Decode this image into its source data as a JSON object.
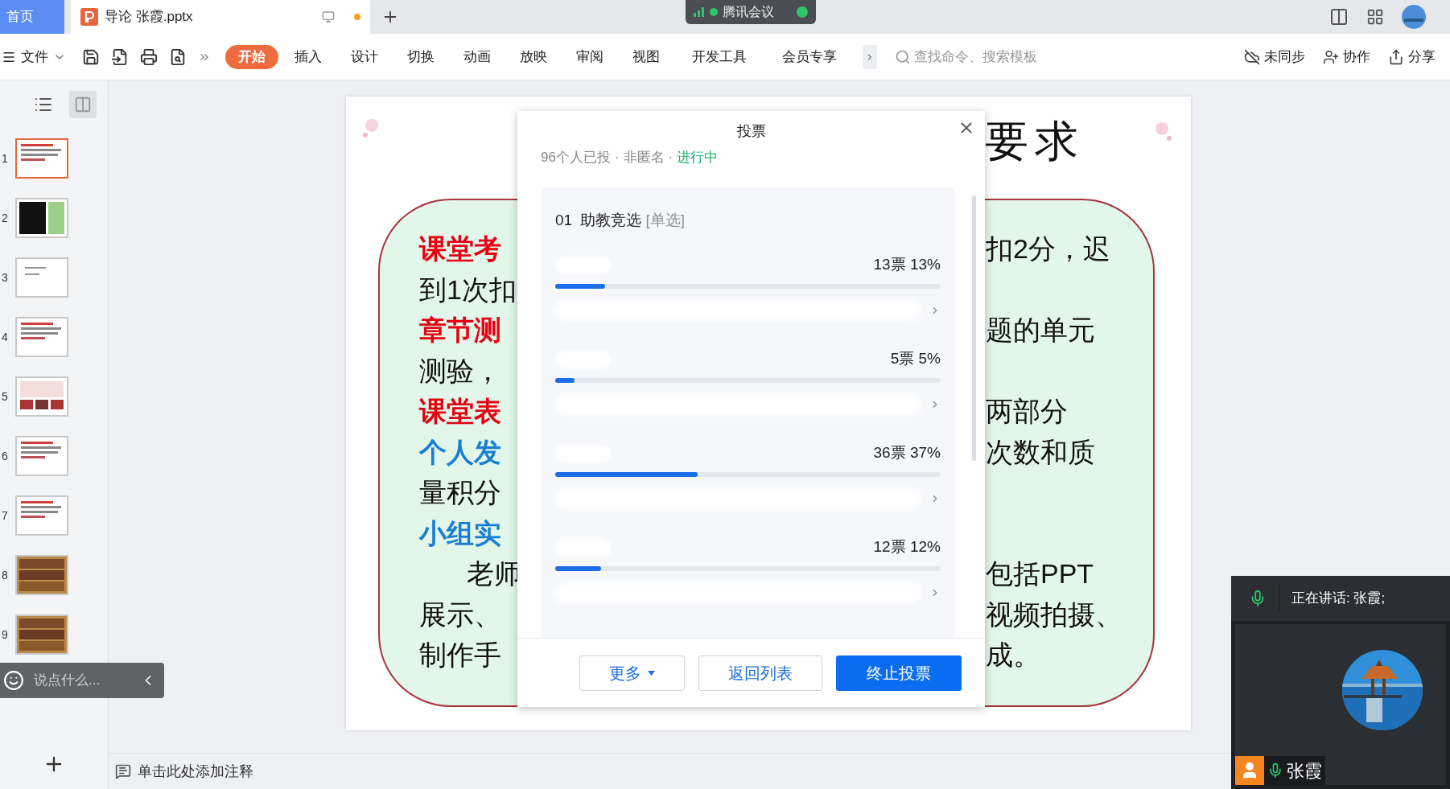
{
  "tabs": [
    {
      "label": "首页",
      "kind": "home",
      "selected": false
    },
    {
      "label": "导论 张霞.pptx",
      "kind": "doc",
      "selected": true,
      "unsaved": true
    }
  ],
  "meeting": {
    "title": "腾讯会议"
  },
  "menu": {
    "label": "文件"
  },
  "ribbon_tabs": [
    {
      "label": "开始",
      "selected": true
    },
    {
      "label": "插入",
      "selected": false
    },
    {
      "label": "设计",
      "selected": false
    },
    {
      "label": "切换",
      "selected": false
    },
    {
      "label": "动画",
      "selected": false
    },
    {
      "label": "放映",
      "selected": false
    },
    {
      "label": "审阅",
      "selected": false
    },
    {
      "label": "视图",
      "selected": false
    },
    {
      "label": "开发工具",
      "selected": false
    },
    {
      "label": "会员专享",
      "selected": false
    }
  ],
  "search": {
    "placeholder": "查找命令、搜索模板"
  },
  "actions": [
    {
      "label": "未同步",
      "kind": "cloud"
    },
    {
      "label": "协作",
      "kind": "people"
    },
    {
      "label": "分享",
      "kind": "share"
    }
  ],
  "thumbnails": [
    {
      "number": "1",
      "kind": "text",
      "selected": true
    },
    {
      "number": "2",
      "kind": "table",
      "selected": false
    },
    {
      "number": "3",
      "kind": "blank",
      "selected": false
    },
    {
      "number": "4",
      "kind": "text",
      "selected": false
    },
    {
      "number": "5",
      "kind": "photos",
      "selected": false
    },
    {
      "number": "6",
      "kind": "text",
      "selected": false
    },
    {
      "number": "7",
      "kind": "text",
      "selected": false
    },
    {
      "number": "8",
      "kind": "shelf",
      "selected": false
    },
    {
      "number": "9",
      "kind": "shelf",
      "selected": false
    }
  ],
  "chat": {
    "placeholder": "说点什么..."
  },
  "slide": {
    "title_right": "要求",
    "rows": [
      {
        "left": "课堂考",
        "color": "#e60012",
        "right": "扣2分，迟",
        "indent": false
      },
      {
        "left": "到1次扣",
        "color": "#111111",
        "indent": false
      },
      {
        "left": "章节测",
        "color": "#e60012",
        "right": "题的单元",
        "indent": false
      },
      {
        "left": "测验，",
        "color": "#111111",
        "indent": false
      },
      {
        "left": "课堂表",
        "color": "#e60012",
        "right": "两部分",
        "indent": false
      },
      {
        "left": "个人发",
        "color": "#1a7fd4",
        "right": "次数和质",
        "indent": false
      },
      {
        "left": "量积分",
        "color": "#111111",
        "indent": false
      },
      {
        "left": "小组实",
        "color": "#1a7fd4",
        "indent": false
      },
      {
        "left": "老师",
        "color": "#111111",
        "right": "包括PPT",
        "indent": true
      },
      {
        "left": "展示、",
        "color": "#111111",
        "right": "视频拍摄、",
        "indent": false
      },
      {
        "left": "制作手",
        "color": "#111111",
        "right": "成。",
        "indent": false
      }
    ]
  },
  "poll": {
    "title": "投票",
    "voters": "96个人已投",
    "separator": "·",
    "anonymity": "非匿名",
    "status": "进行中",
    "question_no": "01",
    "question": "助教竞选",
    "question_type": "[单选]",
    "options": [
      {
        "count": "13票 13%",
        "level": 0.13
      },
      {
        "count": "5票 5%",
        "level": 0.05
      },
      {
        "count": "36票 37%",
        "level": 0.37
      },
      {
        "count": "12票 12%",
        "level": 0.12
      }
    ],
    "buttons": [
      {
        "label": "更多",
        "kind": "dropdown"
      },
      {
        "label": "返回列表",
        "kind": "outline"
      },
      {
        "label": "终止投票",
        "kind": "primary"
      }
    ]
  },
  "notes": {
    "placeholder": "单击此处添加注释"
  },
  "video": {
    "speaking": "正在讲话: 张霞;",
    "name": "张霞"
  }
}
